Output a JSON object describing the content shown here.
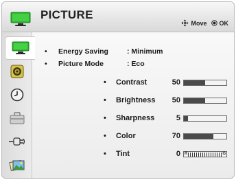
{
  "header": {
    "title": "PICTURE",
    "nav_hint": "Move",
    "ok_hint": "OK",
    "title_icon": "tv-icon",
    "nav_icon": "move-arrows-icon",
    "ok_icon": "ok-dot-icon"
  },
  "sidebar": {
    "items": [
      {
        "icon": "picture-tv-icon",
        "active": true
      },
      {
        "icon": "audio-speaker-icon",
        "active": false
      },
      {
        "icon": "time-clock-icon",
        "active": false
      },
      {
        "icon": "setup-toolbox-icon",
        "active": false
      },
      {
        "icon": "input-plug-icon",
        "active": false
      },
      {
        "icon": "photos-icon",
        "active": false
      }
    ]
  },
  "info": [
    {
      "label": "Energy Saving",
      "value": ": Minimum"
    },
    {
      "label": "Picture Mode",
      "value": ": Eco"
    }
  ],
  "settings": [
    {
      "label": "Contrast",
      "value": "50",
      "level": 0.5
    },
    {
      "label": "Brightness",
      "value": "50",
      "level": 0.5
    },
    {
      "label": "Sharpness",
      "value": "5",
      "level": 0.1
    },
    {
      "label": "Color",
      "value": "70",
      "level": 0.7
    }
  ],
  "tint": {
    "label": "Tint",
    "value": "0",
    "left_mark": "R",
    "right_mark": "G"
  },
  "bullet": "•",
  "colors": {
    "accent_green": "#2db82d",
    "bar_fill": "#4a4a4a"
  }
}
